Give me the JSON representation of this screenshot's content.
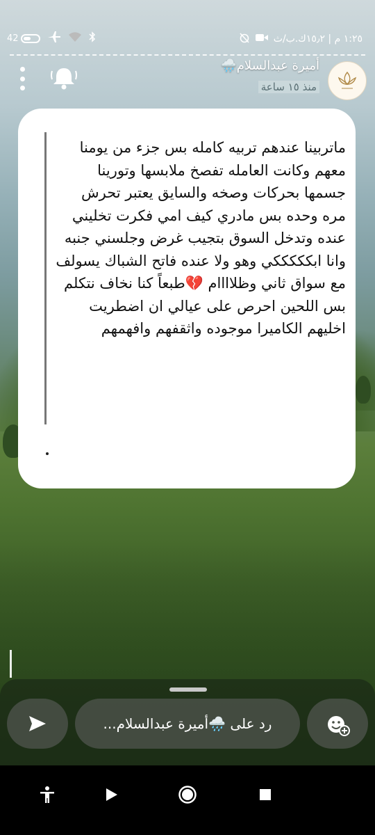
{
  "status_bar": {
    "time": "١:٢٥ م | ١٥٫٢ك.ب/ث",
    "battery": "42",
    "icons": [
      "video-icon",
      "no-alarm-icon",
      "bluetooth-icon",
      "wifi-icon",
      "airplane-icon",
      "battery-icon"
    ]
  },
  "story": {
    "sender_name": "أميرة عبدالسلام🌧️",
    "time_ago": "منذ ١٥ ساعة",
    "avatar_icon": "lotus-logo-icon",
    "message": "ماتربينا عندهم تربيه كامله بس جزء من يومنا معهم وكانت العامله تفصخ ملابسها وتورينا جسمها بحركات وصخه والسايق يعتبر تحرش مره وحده بس مادري كيف امي فكرت تخليني عنده وتدخل السوق بتجيب غرض وجلسني جنبه\nوانا ابكككككي وهو ولا عنده فاتح الشباك يسولف مع سواق ثاني وظلاااام 💔طبعاً كنا نخاف نتكلم بس اللحين احرص على عيالي ان اضطريت اخليهم الكاميرا موجوده واثقفهم وافهمهم"
  },
  "reply": {
    "placeholder": "رد على 🌧️أميرة عبدالسلام..."
  },
  "colors": {
    "card_bg": "#ffffff",
    "panel_bg": "#464e44"
  }
}
